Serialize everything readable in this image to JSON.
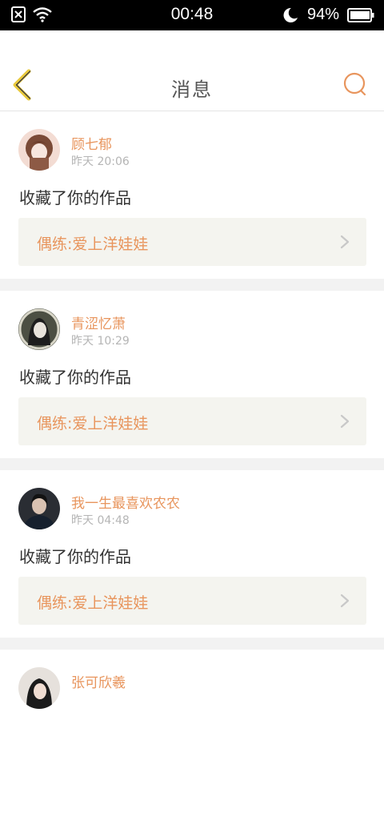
{
  "status_bar": {
    "time": "00:48",
    "battery": "94%",
    "icons": [
      "sim-blocked-icon",
      "wifi-icon",
      "moon-icon",
      "battery-icon"
    ]
  },
  "header": {
    "title": "消息",
    "back_icon": "chevron-left-icon",
    "search_icon": "search-icon"
  },
  "colors": {
    "accent": "#e8955d",
    "back_arrow": "#e9c93c",
    "card_bg": "#f4f4ef",
    "separator": "#f2f2f2"
  },
  "messages": [
    {
      "username": "顾七郁",
      "time": "昨天 20:06",
      "action": "收藏了你的作品",
      "work": "偶练:爱上洋娃娃"
    },
    {
      "username": "青涩忆萧",
      "time": "昨天 10:29",
      "action": "收藏了你的作品",
      "work": "偶练:爱上洋娃娃"
    },
    {
      "username": "我一生最喜欢农农",
      "time": "昨天 04:48",
      "action": "收藏了你的作品",
      "work": "偶练:爱上洋娃娃"
    },
    {
      "username": "张可欣羲",
      "time": "",
      "action": "",
      "work": ""
    }
  ]
}
